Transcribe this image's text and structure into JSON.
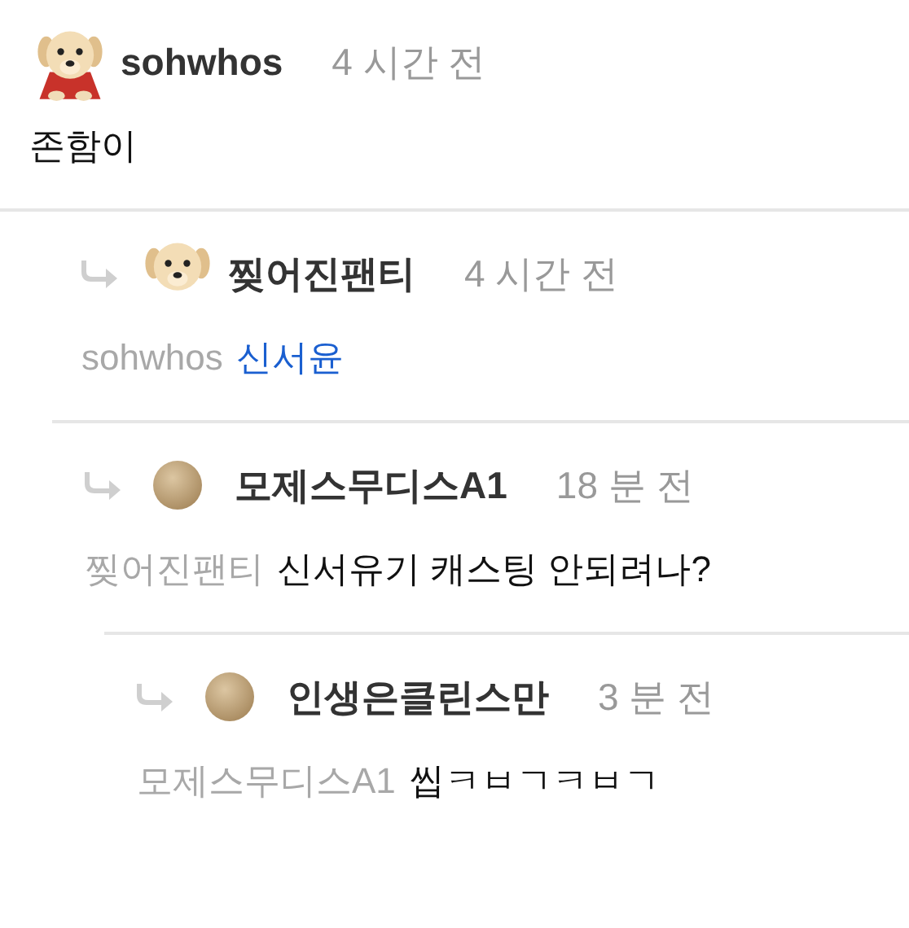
{
  "comments": [
    {
      "kind": "puppy-cape",
      "author": "sohwhos",
      "time": "4 시간 전",
      "body": "존함이",
      "body_link": false,
      "children": [
        {
          "kind": "puppy",
          "author": "찢어진팬티",
          "time": "4 시간 전",
          "mention": "sohwhos",
          "body": "신서윤",
          "body_link": true,
          "children": [
            {
              "kind": "plain",
              "author": "모제스무디스A1",
              "time": "18 분 전",
              "mention": "찢어진팬티",
              "body": "신서유기 캐스팅 안되려나?",
              "body_link": false,
              "children": [
                {
                  "kind": "plain",
                  "author": "인생은클린스만",
                  "time": "3 분 전",
                  "mention": "모제스무디스A1",
                  "body": "씹ㅋㅂㄱㅋㅂㄱ",
                  "body_link": false
                }
              ]
            }
          ]
        }
      ]
    }
  ]
}
